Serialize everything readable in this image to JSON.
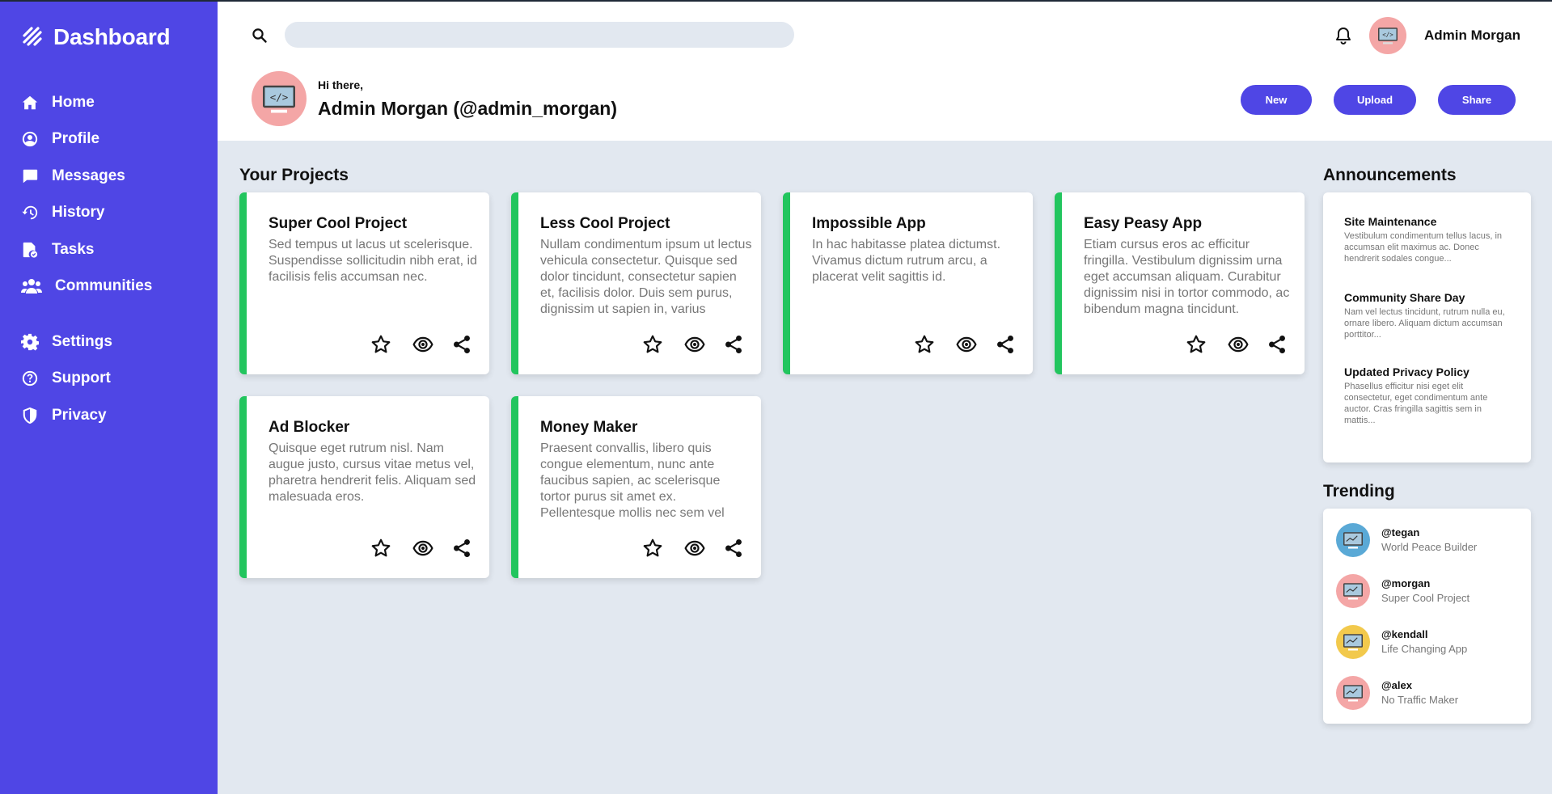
{
  "sidebar": {
    "brand": "Dashboard",
    "items": [
      {
        "label": "Home",
        "icon": "home-icon"
      },
      {
        "label": "Profile",
        "icon": "user-circle-icon"
      },
      {
        "label": "Messages",
        "icon": "message-icon"
      },
      {
        "label": "History",
        "icon": "history-icon"
      },
      {
        "label": "Tasks",
        "icon": "tasks-icon"
      },
      {
        "label": "Communities",
        "icon": "users-icon"
      }
    ],
    "secondary": [
      {
        "label": "Settings",
        "icon": "gear-icon"
      },
      {
        "label": "Support",
        "icon": "help-icon"
      },
      {
        "label": "Privacy",
        "icon": "shield-icon"
      }
    ]
  },
  "header": {
    "search_placeholder": "",
    "username": "Admin Morgan",
    "greeting": "Hi there,",
    "full_name": "Admin Morgan (@admin_morgan)",
    "buttons": {
      "new": "New",
      "upload": "Upload",
      "share": "Share"
    }
  },
  "projects": {
    "title": "Your Projects",
    "items": [
      {
        "title": "Super Cool Project",
        "desc": "Sed tempus ut lacus ut scelerisque. Suspendisse sollicitudin nibh erat, id facilisis felis accumsan nec."
      },
      {
        "title": "Less Cool Project",
        "desc": "Nullam condimentum ipsum ut lectus vehicula consectetur. Quisque sed dolor tincidunt, consectetur sapien et, facilisis dolor. Duis sem purus, dignissim ut sapien in, varius"
      },
      {
        "title": "Impossible App",
        "desc": "In hac habitasse platea dictumst. Vivamus dictum rutrum arcu, a placerat velit sagittis id."
      },
      {
        "title": "Easy Peasy App",
        "desc": "Etiam cursus eros ac efficitur fringilla. Vestibulum dignissim urna eget accumsan aliquam. Curabitur dignissim nisi in tortor commodo, ac bibendum magna tincidunt."
      },
      {
        "title": "Ad Blocker",
        "desc": "Quisque eget rutrum nisl. Nam augue justo, cursus vitae metus vel, pharetra hendrerit felis. Aliquam sed malesuada eros."
      },
      {
        "title": "Money Maker",
        "desc": "Praesent convallis, libero quis congue elementum, nunc ante faucibus sapien, ac scelerisque tortor purus sit amet ex. Pellentesque mollis nec sem vel aliquam."
      }
    ]
  },
  "announcements": {
    "title": "Announcements",
    "items": [
      {
        "title": "Site Maintenance",
        "body": "Vestibulum condimentum tellus lacus, in accumsan elit maximus ac. Donec hendrerit sodales congue..."
      },
      {
        "title": "Community Share Day",
        "body": "Nam vel lectus tincidunt, rutrum nulla eu, ornare libero. Aliquam dictum accumsan porttitor..."
      },
      {
        "title": "Updated Privacy Policy",
        "body": "Phasellus efficitur nisi eget elit consectetur, eget condimentum ante auctor. Cras fringilla sagittis sem in mattis..."
      }
    ]
  },
  "trending": {
    "title": "Trending",
    "items": [
      {
        "handle": "@tegan",
        "project": "World Peace Builder",
        "avatar_color": "#5aa9d6"
      },
      {
        "handle": "@morgan",
        "project": "Super Cool Project",
        "avatar_color": "#f4a6a6"
      },
      {
        "handle": "@kendall",
        "project": "Life Changing App",
        "avatar_color": "#f2c94c"
      },
      {
        "handle": "@alex",
        "project": "No Traffic Maker",
        "avatar_color": "#f4a6a6"
      }
    ]
  },
  "colors": {
    "accent": "#4f46e5",
    "card_border": "#22c55e",
    "background": "#e2e8f0"
  }
}
